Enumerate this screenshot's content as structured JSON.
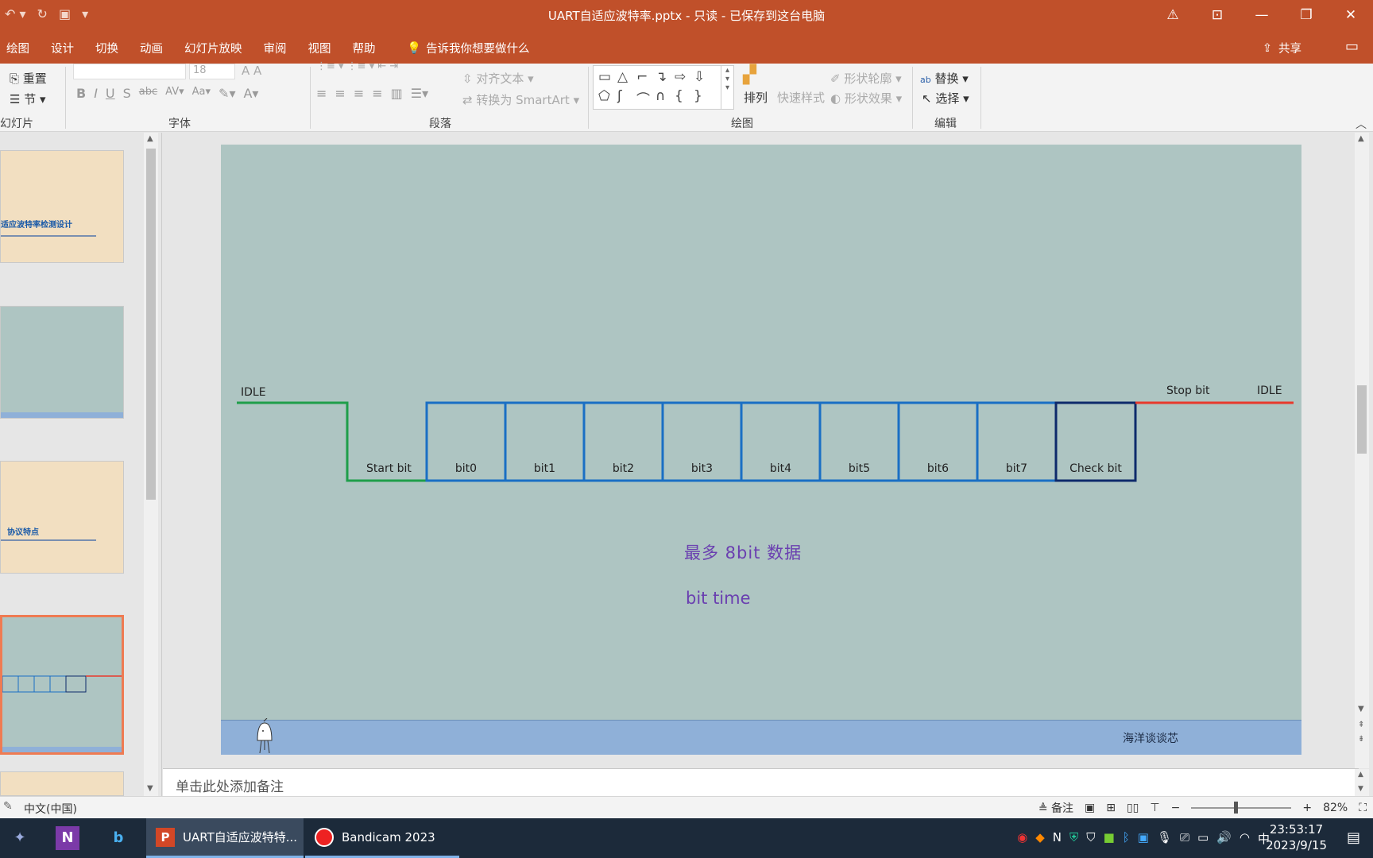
{
  "window": {
    "title": "UART自适应波特率.pptx  -  只读  -  已保存到这台电脑",
    "warning_icon": "warning-icon"
  },
  "menu": {
    "items": [
      "绘图",
      "设计",
      "切换",
      "动画",
      "幻灯片放映",
      "审阅",
      "视图",
      "帮助"
    ],
    "tell_me": "告诉我你想要做什么",
    "share": "共享"
  },
  "ribbon": {
    "reset_label": "重置",
    "section_label": "节",
    "slides_group": "幻灯片",
    "font_size": "18",
    "font_group": "字体",
    "align_text": "对齐文本",
    "convert_smartart": "转换为 SmartArt",
    "paragraph_group": "段落",
    "arrange": "排列",
    "quick_styles": "快速样式",
    "shape_outline": "形状轮廓",
    "shape_effects": "形状效果",
    "drawing_group": "绘图",
    "replace": "替换",
    "select": "选择",
    "editing_group": "编辑"
  },
  "thumbnails": {
    "t1_title": "适应波特率检测设计",
    "t3_title": "协议特点"
  },
  "slide": {
    "idle_left": "IDLE",
    "idle_right": "IDLE",
    "stop_bit": "Stop bit",
    "start_bit": "Start bit",
    "bits": [
      "bit0",
      "bit1",
      "bit2",
      "bit3",
      "bit4",
      "bit5",
      "bit6",
      "bit7"
    ],
    "check_bit": "Check bit",
    "caption_main": "最多 8bit 数据",
    "caption_sub": "bit time",
    "footer_brand": "海洋谈谈芯",
    "colors": {
      "idle": "#1f9e4a",
      "data": "#1a6fc4",
      "check": "#0e2a6b",
      "stop": "#e8392c",
      "caption": "#6a3fb0"
    }
  },
  "notes": {
    "placeholder": "单击此处添加备注"
  },
  "status": {
    "language": "中文(中国)",
    "notes_label": "备注",
    "zoom": "82%"
  },
  "taskbar": {
    "ppt_task": "UART自适应波特特...",
    "bandicam_task": "Bandicam 2023",
    "time": "23:53:17",
    "date": "2023/9/15",
    "ime": "中"
  }
}
